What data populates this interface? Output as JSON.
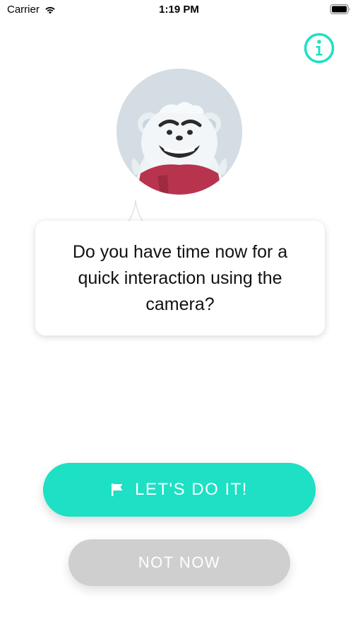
{
  "status_bar": {
    "carrier": "Carrier",
    "time": "1:19 PM",
    "wifi_icon": "wifi-icon",
    "battery_icon": "battery-icon"
  },
  "header": {
    "info_icon": "info-icon",
    "accent_color": "#1de0c4"
  },
  "avatar": {
    "icon": "polar-bear-mascot"
  },
  "prompt": {
    "question": "Do you have time now for a quick interaction using the camera?"
  },
  "actions": {
    "confirm_label": "LET'S DO IT!",
    "confirm_icon": "flag-icon",
    "confirm_color": "#1de0c4",
    "decline_label": "NOT NOW",
    "decline_color": "#cfcfcf"
  }
}
